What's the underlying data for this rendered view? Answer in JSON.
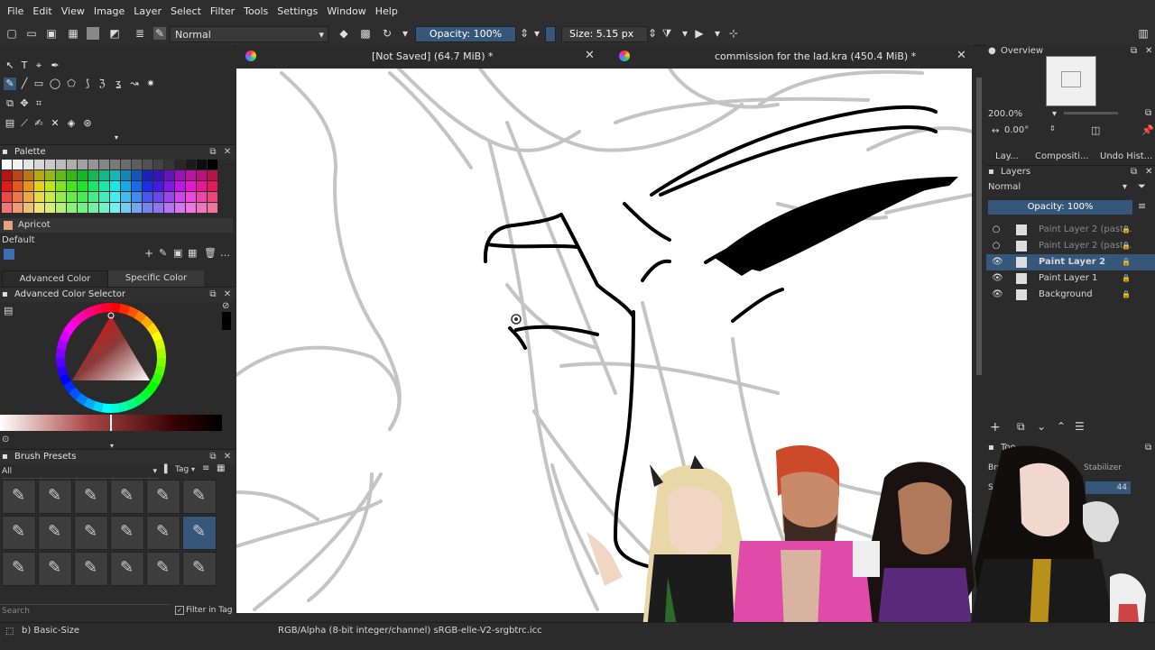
{
  "menu": [
    "File",
    "Edit",
    "View",
    "Image",
    "Layer",
    "Select",
    "Filter",
    "Tools",
    "Settings",
    "Window",
    "Help"
  ],
  "toolbar": {
    "blend_mode": "Normal",
    "opacity": "Opacity: 100%",
    "size": "Size: 5.15 px"
  },
  "tabs": [
    {
      "title": "[Not Saved]  (64.7 MiB) *"
    },
    {
      "title": "commission for the lad.kra (450.4 MiB) *"
    }
  ],
  "palette": {
    "title": "Palette",
    "selected_color": "Apricot",
    "tag": "Default"
  },
  "color_tabs": [
    "Advanced Color Selector",
    "Specific Color Selector"
  ],
  "advanced_color": {
    "title": "Advanced Color Selector"
  },
  "brush_presets": {
    "title": "Brush Presets",
    "filter": "All",
    "tag_label": "Tag",
    "search_placeholder": "Search",
    "filter_in_tag": "Filter in Tag"
  },
  "overview": {
    "title": "Overview",
    "zoom": "200.0%",
    "rotation": "0.00°"
  },
  "right_tabs": [
    "Lay...",
    "Compositi...",
    "Undo Hist..."
  ],
  "layers": {
    "title": "Layers",
    "blend_mode": "Normal",
    "opacity": "Opacity:  100%",
    "items": [
      {
        "name": "Paint Layer 2 (past...",
        "visible": false
      },
      {
        "name": "Paint Layer 2 (past...",
        "visible": false
      },
      {
        "name": "Paint Layer 2",
        "visible": true,
        "active": true
      },
      {
        "name": "Paint Layer 1",
        "visible": true
      },
      {
        "name": "Background",
        "visible": true
      }
    ]
  },
  "tool_options": {
    "title": "Too",
    "brush_label": "Brus",
    "stabilizer": "Stabilizer",
    "sa_label": "Sa",
    "value": "44"
  },
  "status": {
    "brush": "b) Basic-Size",
    "color_space": "RGB/Alpha (8-bit integer/channel)  sRGB-elle-V2-srgbtrc.icc"
  },
  "colors": {
    "accent": "#36577a",
    "panel": "#2b2b2b",
    "canvas": "#ffffff"
  }
}
